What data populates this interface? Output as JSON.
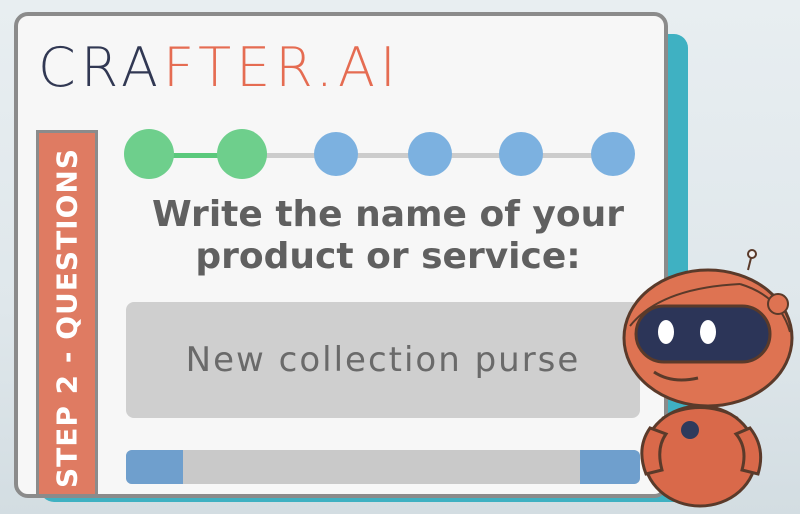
{
  "brand": {
    "logo_main": "CRA",
    "logo_accent": "FTER.AI",
    "colors": {
      "dark": "#313853",
      "accent": "#e56c52"
    }
  },
  "step": {
    "label": "STEP 2 - QUESTIONS"
  },
  "progress": {
    "current_step": 2,
    "total_steps": 6
  },
  "question": {
    "line1": "Write the name of your",
    "line2": "product or service:"
  },
  "answer": {
    "value": "New collection purse"
  },
  "colors": {
    "card_border": "#8b8b8b",
    "teal": "#3fb1c2",
    "step_done": "#6ecf8c",
    "step_todo": "#7cb1e0",
    "ribbon": "#df7b62"
  },
  "mascot": {
    "icon": "robot-mascot-icon"
  }
}
